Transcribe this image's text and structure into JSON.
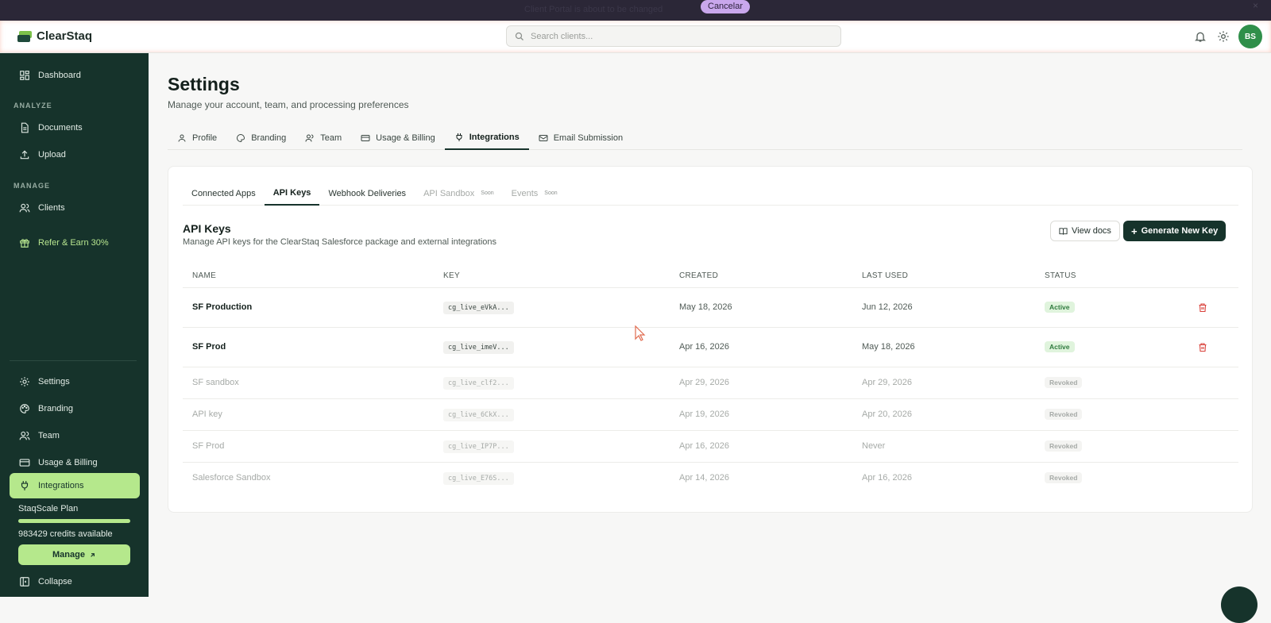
{
  "banner": {
    "message": "Client Portal is about to be changed",
    "cancel_label": "Cancelar",
    "close": "×"
  },
  "app": {
    "name": "ClearStaq"
  },
  "search": {
    "placeholder": "Search clients..."
  },
  "user": {
    "initials": "BS"
  },
  "sidebar": {
    "dashboard": "Dashboard",
    "analyze_heading": "ANALYZE",
    "documents": "Documents",
    "upload": "Upload",
    "manage_heading": "MANAGE",
    "clients": "Clients",
    "refer": "Refer & Earn 30%",
    "settings": "Settings",
    "branding": "Branding",
    "team": "Team",
    "usage": "Usage & Billing",
    "integrations": "Integrations",
    "plan_name": "StaqScale Plan",
    "plan_fill": 1.0,
    "credits": "983429 credits available",
    "manage_label": "Manage",
    "collapse": "Collapse"
  },
  "page": {
    "title": "Settings",
    "subtitle": "Manage your account, team, and processing preferences",
    "tabs": [
      "Profile",
      "Branding",
      "Team",
      "Usage & Billing",
      "Integrations",
      "Email Submission"
    ],
    "active_tab": "Integrations"
  },
  "integrations": {
    "subtabs": [
      "Connected Apps",
      "API Keys",
      "Webhook Deliveries",
      "API Sandbox",
      "Events"
    ],
    "soon_label": "Soon",
    "section_title": "API Keys",
    "section_sub": "Manage API keys for the ClearStaq Salesforce package and external integrations",
    "view_docs": "View docs",
    "generate": "Generate New Key",
    "columns": [
      "NAME",
      "KEY",
      "CREATED",
      "LAST USED",
      "STATUS"
    ],
    "rows": [
      {
        "name": "SF Production",
        "key": "cg_live_eVkA...",
        "created": "May 18, 2026",
        "last_used": "Jun 12, 2026",
        "status": "Active"
      },
      {
        "name": "SF Prod",
        "key": "cg_live_imeV...",
        "created": "Apr 16, 2026",
        "last_used": "May 18, 2026",
        "status": "Active"
      },
      {
        "name": "SF sandbox",
        "key": "cg_live_clf2...",
        "created": "Apr 29, 2026",
        "last_used": "Apr 29, 2026",
        "status": "Revoked"
      },
      {
        "name": "API key",
        "key": "cg_live_6CkX...",
        "created": "Apr 19, 2026",
        "last_used": "Apr 20, 2026",
        "status": "Revoked"
      },
      {
        "name": "SF Prod",
        "key": "cg_live_IP7P...",
        "created": "Apr 16, 2026",
        "last_used": "Never",
        "status": "Revoked"
      },
      {
        "name": "Salesforce Sandbox",
        "key": "cg_live_E76S...",
        "created": "Apr 14, 2026",
        "last_used": "Apr 16, 2026",
        "status": "Revoked"
      }
    ]
  },
  "colors": {
    "sidebar_bg": "#16332b",
    "accent": "#b5e88c",
    "danger": "#d9403a",
    "avatar": "#2f8f4a"
  }
}
